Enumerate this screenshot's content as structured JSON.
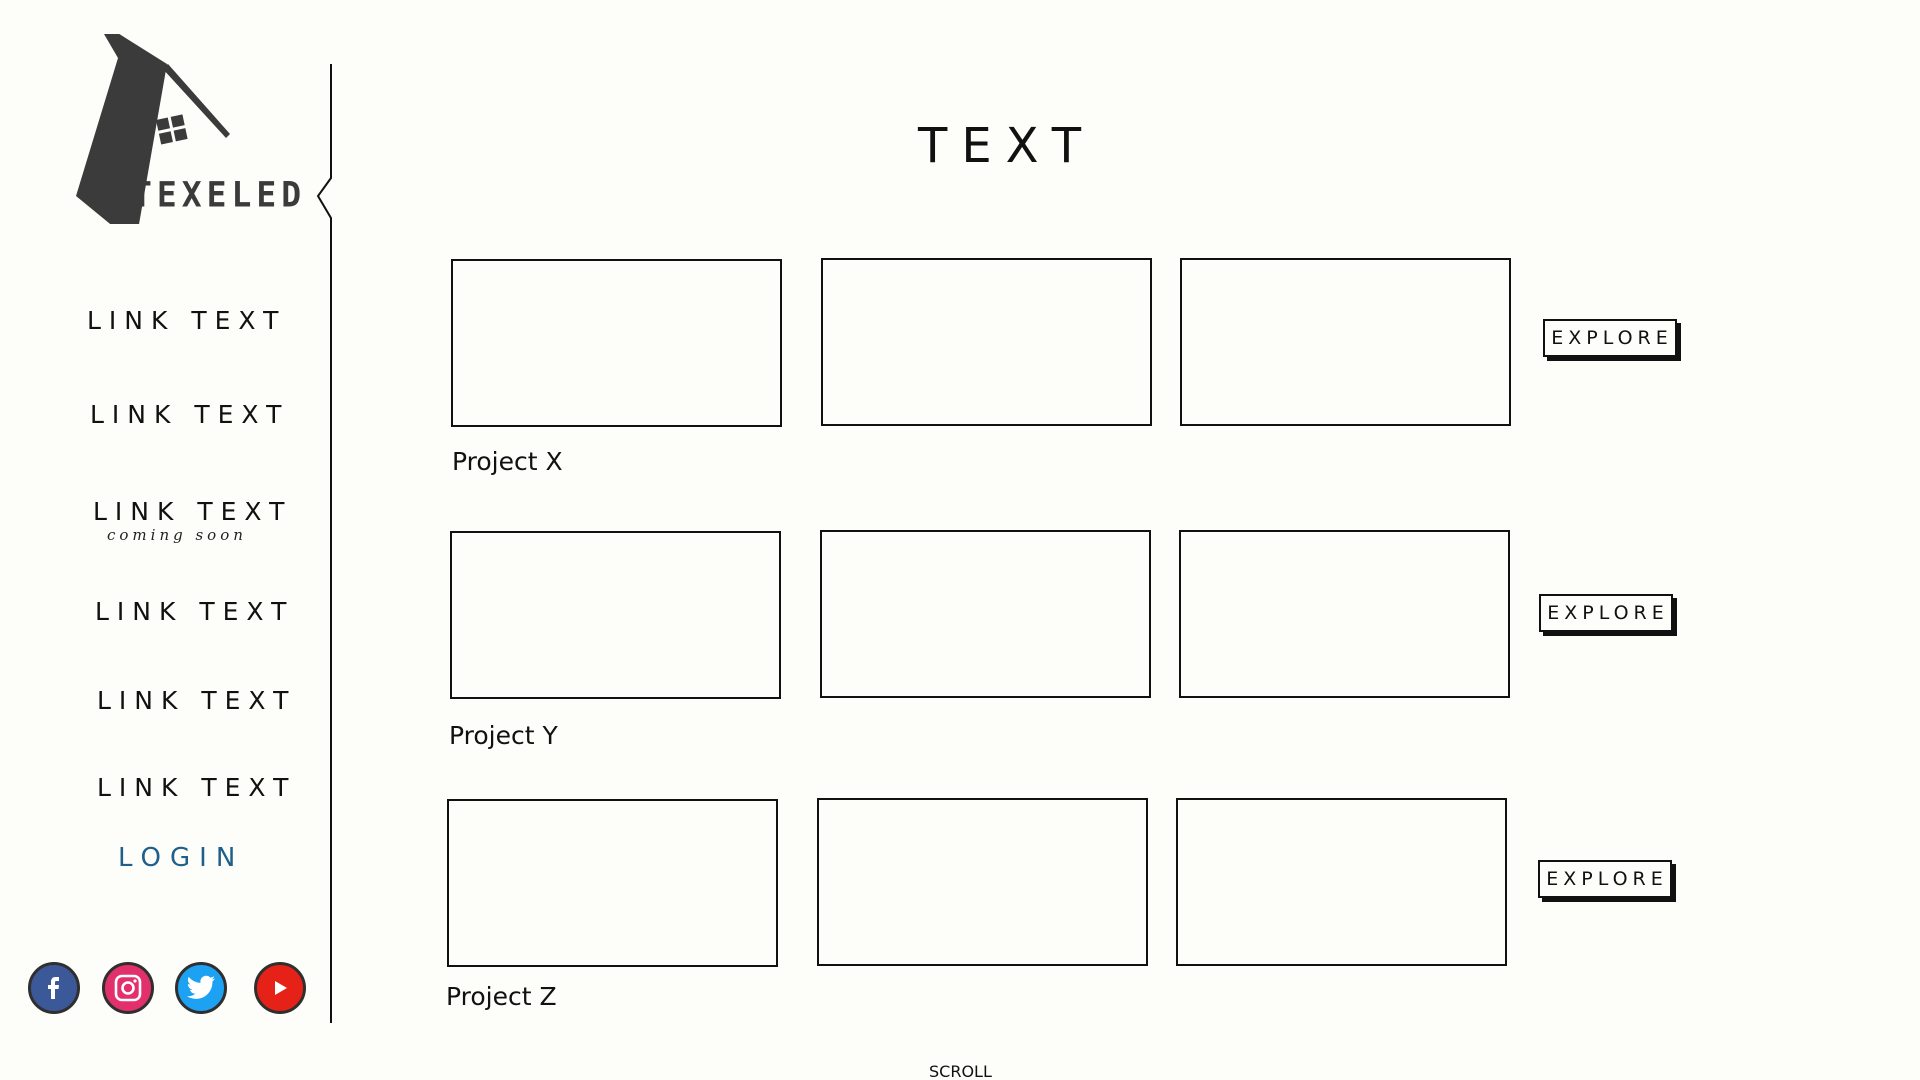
{
  "brand": {
    "name": "TEXELED"
  },
  "sidebar": {
    "nav_items": [
      {
        "label": "LINK TEXT"
      },
      {
        "label": "LINK TEXT"
      },
      {
        "label": "LINK TEXT",
        "sub": "coming soon"
      },
      {
        "label": "LINK TEXT"
      },
      {
        "label": "LINK TEXT"
      },
      {
        "label": "LINK TEXT"
      }
    ],
    "login_label": "LOGIN",
    "social": [
      {
        "icon": "facebook-icon",
        "color": "#3b5998"
      },
      {
        "icon": "instagram-icon",
        "color": "#e1306c"
      },
      {
        "icon": "twitter-icon",
        "color": "#1da1f2"
      },
      {
        "icon": "youtube-icon",
        "color": "#e62117"
      }
    ]
  },
  "main": {
    "title": "TEXT",
    "projects": [
      {
        "name": "Project X",
        "explore_label": "EXPLORE"
      },
      {
        "name": "Project Y",
        "explore_label": "EXPLORE"
      },
      {
        "name": "Project Z",
        "explore_label": "EXPLORE"
      }
    ],
    "scroll_label": "SCROLL"
  },
  "colors": {
    "background": "#fdfdf9",
    "ink": "#111111",
    "login": "#1f5f8b",
    "logo": "#3b3b3b"
  }
}
